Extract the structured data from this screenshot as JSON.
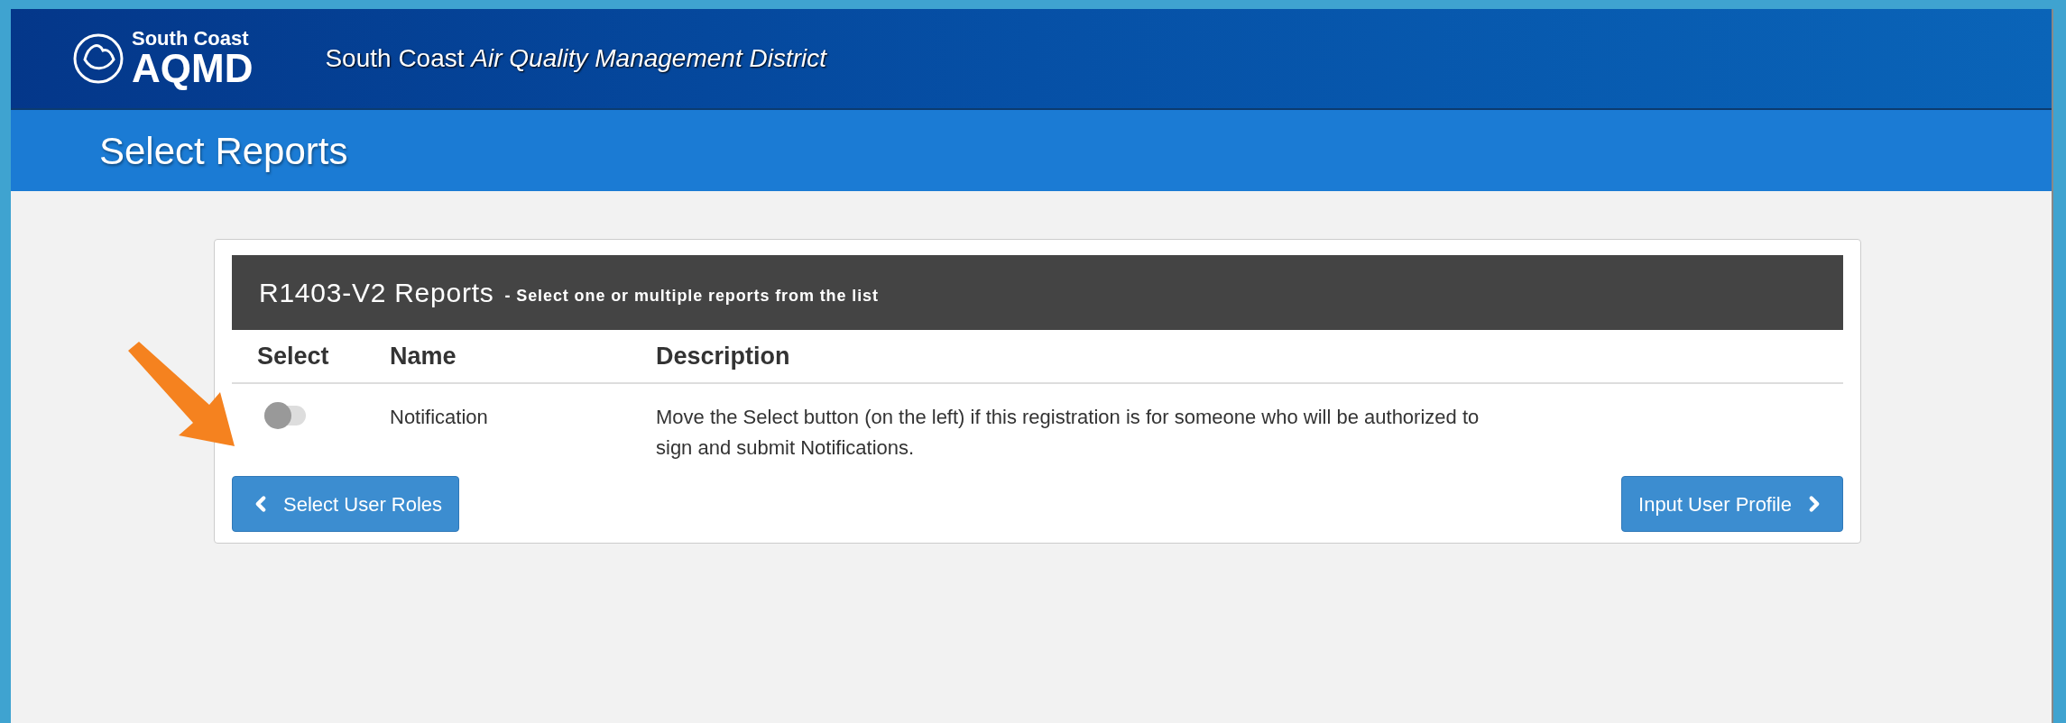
{
  "header": {
    "logo_top": "South Coast",
    "logo_main": "AQMD",
    "title_plain": "South Coast",
    "title_italic": "Air Quality Management District"
  },
  "page_title": "Select Reports",
  "panel": {
    "title": "R1403-V2 Reports",
    "subtitle": "- Select one or multiple reports from the list"
  },
  "table": {
    "columns": [
      "Select",
      "Name",
      "Description"
    ],
    "rows": [
      {
        "selected": false,
        "name": "Notification",
        "description": "Move the Select button (on the left) if this registration is for someone who will be authorized to sign and submit Notifications."
      }
    ]
  },
  "buttons": {
    "back": "Select User Roles",
    "next": "Input User Profile"
  }
}
